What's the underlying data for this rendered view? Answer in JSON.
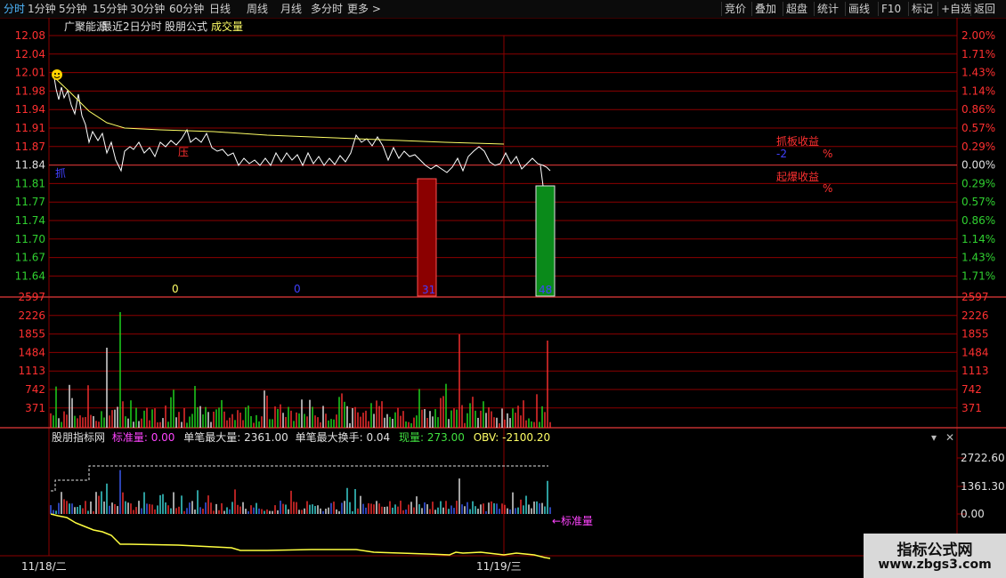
{
  "toolbar": {
    "left": [
      "分时",
      "1分钟",
      "5分钟",
      "15分钟",
      "30分钟",
      "60分钟",
      "日线",
      "周线",
      "月线",
      "多分时",
      "更多 >"
    ],
    "right": [
      "竞价",
      "叠加",
      "超盘",
      "统计",
      "画线",
      "F10",
      "标记",
      "+自选",
      "返回"
    ],
    "active": "分时"
  },
  "header": {
    "stock": "广聚能源",
    "period": "最近2日分时",
    "formula": "股朋公式",
    "indicator": "成交量"
  },
  "price_axis": {
    "left": [
      "12.08",
      "12.04",
      "12.01",
      "11.98",
      "11.94",
      "11.91",
      "11.87",
      "11.84",
      "11.81",
      "11.77",
      "11.74",
      "11.70",
      "11.67",
      "11.64"
    ],
    "right": [
      "2.00%",
      "1.71%",
      "1.43%",
      "1.14%",
      "0.86%",
      "0.57%",
      "0.29%",
      "0.00%",
      "0.29%",
      "0.57%",
      "0.86%",
      "1.14%",
      "1.43%",
      "1.71%"
    ]
  },
  "volume_axis": [
    "2597",
    "2226",
    "1855",
    "1484",
    "1113",
    "742",
    "371"
  ],
  "chart_markers": {
    "ya": "压",
    "zhua": "抓",
    "zero1": "0",
    "zero2": "0",
    "label_red": "31",
    "label_green": "48"
  },
  "side_labels": {
    "zhuaban": "抓板收益",
    "zhuaban_val": "-2",
    "pct1": "%",
    "qibao": "起爆收益",
    "pct2": "%"
  },
  "indicator_panel": {
    "name": "股朋指标网",
    "std_label": "标准量:",
    "std_value": "0.00",
    "max_vol_label": "单笔最大量:",
    "max_vol_value": "2361.00",
    "max_turn_label": "单笔最大换手:",
    "max_turn_value": "0.04",
    "cur_label": "现量:",
    "cur_value": "273.00",
    "obv_label": "OBV:",
    "obv_value": "-2100.20",
    "axis": [
      "2722.60",
      "1361.30",
      "0.00"
    ],
    "std_arrow": "←标准量"
  },
  "dates": [
    "11/18/二",
    "11/19/三"
  ],
  "watermark": {
    "line1": "指标公式网",
    "line2": "www.zbgs3.com"
  },
  "colors": {
    "grid": "#8b0000",
    "up": "#ff2a2a",
    "down": "#1aff1a",
    "price_line": "#ffffff",
    "avg_line": "#ffff66"
  }
}
